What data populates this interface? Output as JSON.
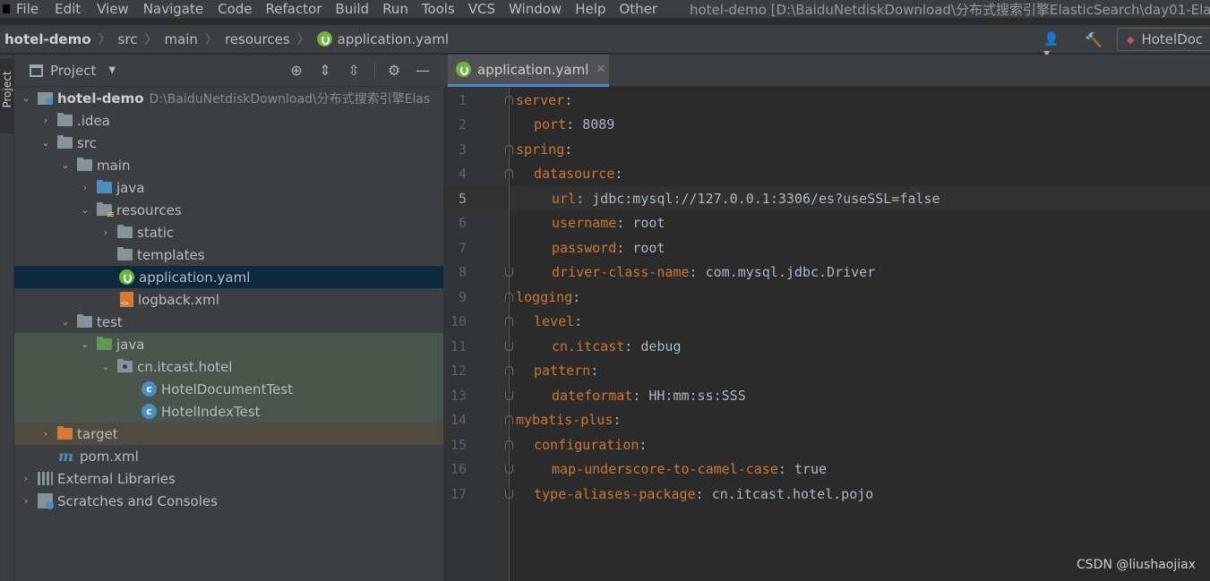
{
  "menubar": {
    "items": [
      "File",
      "Edit",
      "View",
      "Navigate",
      "Code",
      "Refactor",
      "Build",
      "Run",
      "Tools",
      "VCS",
      "Window",
      "Help",
      "Other"
    ],
    "window_title": "hotel-demo [D:\\BaiduNetdiskDownload\\分布式搜索引擎ElasticSearch\\day01-Ela"
  },
  "navbar": {
    "breadcrumbs": [
      "hotel-demo",
      "src",
      "main",
      "resources",
      "application.yaml"
    ],
    "run_config": "HotelDoc"
  },
  "tool_stripe": {
    "project_tab": "Project"
  },
  "project_panel": {
    "title": "Project",
    "tree": [
      {
        "label": "hotel-demo",
        "path": "D:\\BaiduNetdiskDownload\\分布式搜索引擎Elas"
      },
      {
        "label": ".idea"
      },
      {
        "label": "src"
      },
      {
        "label": "main"
      },
      {
        "label": "java"
      },
      {
        "label": "resources"
      },
      {
        "label": "static"
      },
      {
        "label": "templates"
      },
      {
        "label": "application.yaml"
      },
      {
        "label": "logback.xml"
      },
      {
        "label": "test"
      },
      {
        "label": "java"
      },
      {
        "label": "cn.itcast.hotel"
      },
      {
        "label": "HotelDocumentTest"
      },
      {
        "label": "HotelIndexTest"
      },
      {
        "label": "target"
      },
      {
        "label": "pom.xml"
      },
      {
        "label": "External Libraries"
      },
      {
        "label": "Scratches and Consoles"
      }
    ]
  },
  "editor": {
    "tab_label": "application.yaml",
    "current_line": 5,
    "lines": [
      {
        "n": "1",
        "key": "server",
        "val": ""
      },
      {
        "n": "2",
        "key": "port",
        "val": "8089"
      },
      {
        "n": "3",
        "key": "spring",
        "val": ""
      },
      {
        "n": "4",
        "key": "datasource",
        "val": ""
      },
      {
        "n": "5",
        "key": "url",
        "val": "jdbc:mysql://127.0.0.1:3306/es?useSSL=false"
      },
      {
        "n": "6",
        "key": "username",
        "val": "root"
      },
      {
        "n": "7",
        "key": "password",
        "val": "root"
      },
      {
        "n": "8",
        "key": "driver-class-name",
        "val": "com.mysql.jdbc.Driver"
      },
      {
        "n": "9",
        "key": "logging",
        "val": ""
      },
      {
        "n": "10",
        "key": "level",
        "val": ""
      },
      {
        "n": "11",
        "key": "cn.itcast",
        "val": "debug"
      },
      {
        "n": "12",
        "key": "pattern",
        "val": ""
      },
      {
        "n": "13",
        "key": "dateformat",
        "val": "HH:mm:ss:SSS"
      },
      {
        "n": "14",
        "key": "mybatis-plus",
        "val": ""
      },
      {
        "n": "15",
        "key": "configuration",
        "val": ""
      },
      {
        "n": "16",
        "key": "map-underscore-to-camel-case",
        "val": "true"
      },
      {
        "n": "17",
        "key": "type-aliases-package",
        "val": "cn.itcast.hotel.pojo"
      }
    ]
  },
  "watermark": "CSDN @liushaojiax",
  "colors": {
    "yaml_key": "#cc7832",
    "yaml_value": "#a9b7c6",
    "selection": "#0d293e",
    "spring_green": "#6db33f",
    "tab_underline": "#4a88c7"
  }
}
